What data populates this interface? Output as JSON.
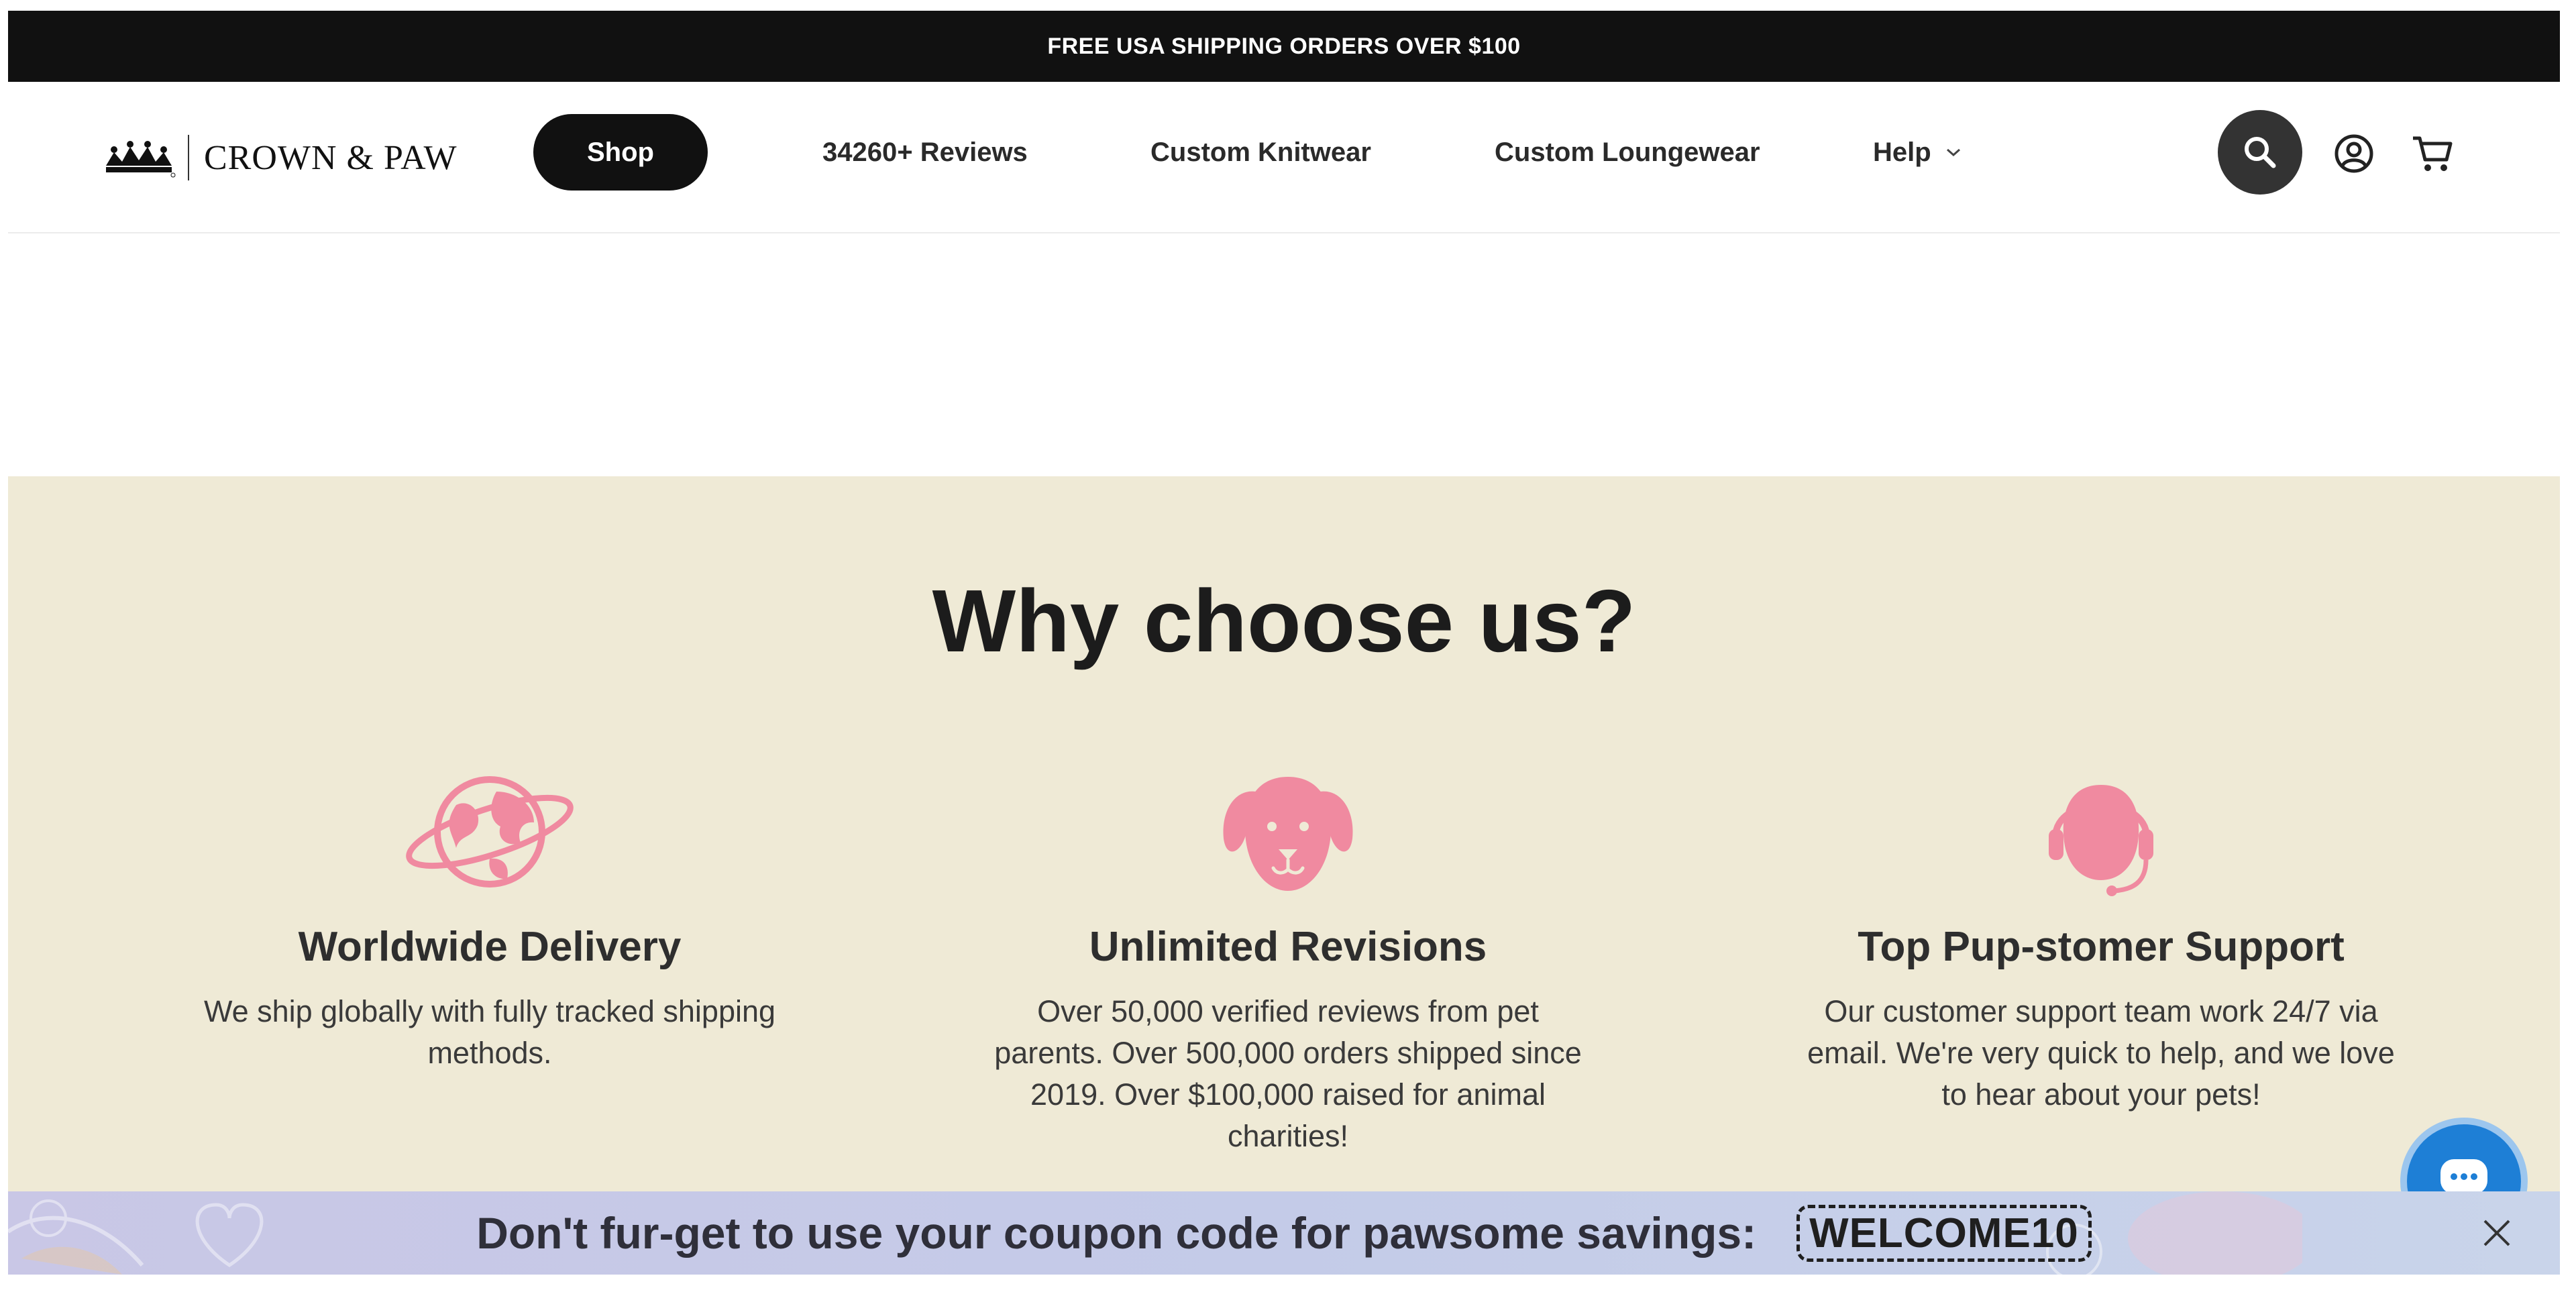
{
  "announcement": {
    "text": "FREE USA SHIPPING ORDERS OVER $100"
  },
  "brand": {
    "name": "CROWN & PAW"
  },
  "nav": {
    "shop": "Shop",
    "reviews": "34260+ Reviews",
    "knitwear": "Custom Knitwear",
    "loungewear": "Custom Loungewear",
    "help": "Help"
  },
  "icons": {
    "search": "search-icon",
    "account": "user-circle-icon",
    "cart": "cart-icon",
    "chat": "chat-bubble-icon",
    "close": "close-icon"
  },
  "why": {
    "title": "Why choose us?",
    "features": [
      {
        "icon": "globe-icon",
        "title": "Worldwide Delivery",
        "text": "We ship globally with fully tracked shipping methods."
      },
      {
        "icon": "dog-face-icon",
        "title": "Unlimited Revisions",
        "text": "Over 50,000 verified reviews from pet parents. Over 500,000 orders shipped since 2019. Over $100,000 raised for animal charities!"
      },
      {
        "icon": "headset-icon",
        "title": "Top Pup-stomer Support",
        "text": "Our customer support team work 24/7 via email. We're very quick to help, and we love to hear about your pets!"
      }
    ]
  },
  "coupon": {
    "text": "Don't fur-get to use your coupon code for pawsome savings:",
    "code": "WELCOME10"
  },
  "colors": {
    "announcement_bg": "#111111",
    "accent_pink": "#f08aa0",
    "section_bg": "#efead6",
    "chat_blue": "#1e7fd6"
  }
}
